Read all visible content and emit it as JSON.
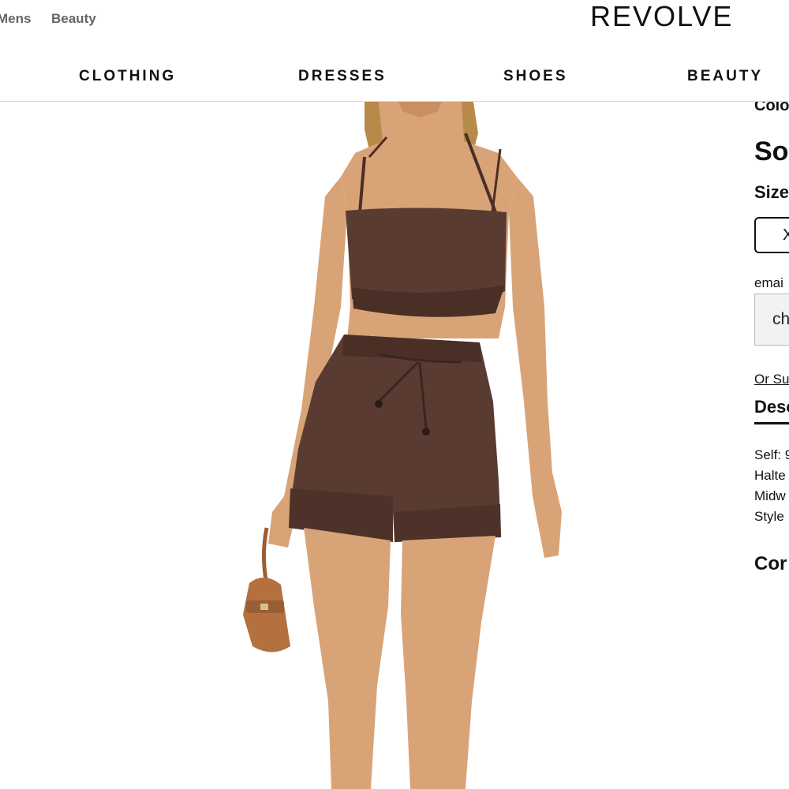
{
  "header": {
    "sub_links": [
      "Mens",
      "Beauty"
    ],
    "logo": "REVOLVE",
    "nav": [
      "CLOTHING",
      "DRESSES",
      "SHOES",
      "BEAUTY"
    ]
  },
  "product_panel": {
    "color_label": "Colo",
    "product_name": "So",
    "size_label": "Size",
    "size_option": "X",
    "email_label": "emai",
    "email_button": "ch",
    "subscribe_link": "Or Sub",
    "description_tab": "Desc",
    "description_lines": [
      "Self: 9",
      "Halte",
      "Midw",
      "Style"
    ],
    "section_heading": "Cor"
  },
  "colors": {
    "garment": "#5a3b31",
    "skin": "#d9a378",
    "bag": "#b5703f",
    "hair": "#b88a4a"
  }
}
